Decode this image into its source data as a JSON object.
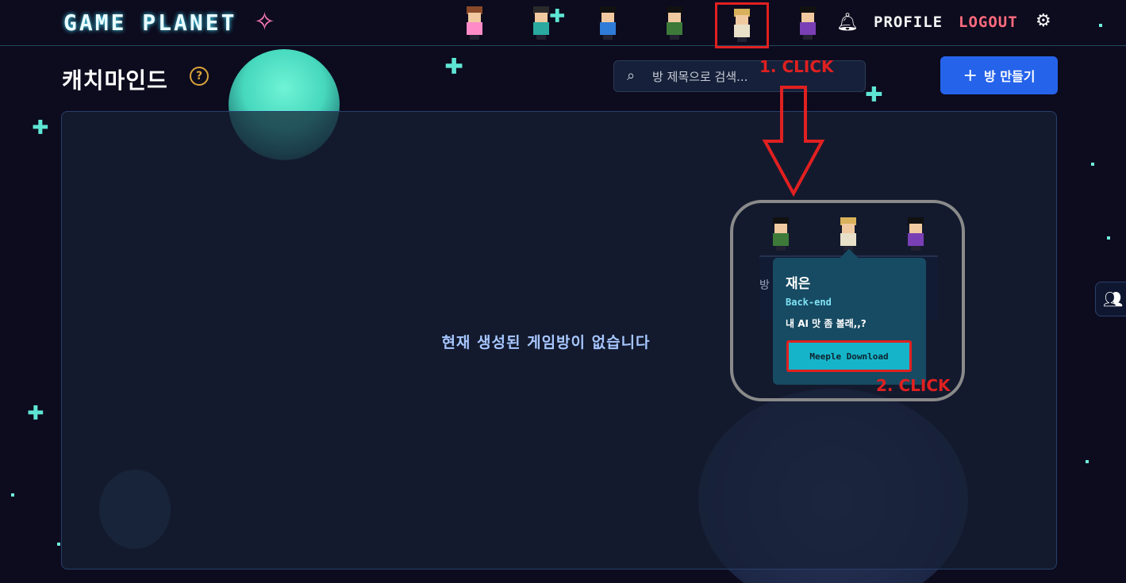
{
  "header": {
    "logo": "GAME PLANET",
    "nav_profile": "PROFILE",
    "nav_logout": "LOGOUT",
    "icons": {
      "logo": "sparkle-icon",
      "bell": "bell-icon",
      "settings": "gear-icon"
    },
    "avatars": [
      {
        "name": "avatar-1",
        "hair": "#8a4a2a",
        "shirt": "#ff8cc8"
      },
      {
        "name": "avatar-2",
        "hair": "#2a2a2a",
        "shirt": "#2aa9a0"
      },
      {
        "name": "avatar-3",
        "hair": "#111111",
        "shirt": "#2f7bd8"
      },
      {
        "name": "avatar-4",
        "hair": "#111111",
        "shirt": "#3d7a3a"
      },
      {
        "name": "avatar-5",
        "hair": "#d8b15a",
        "shirt": "#e8e0c8",
        "selected": true
      },
      {
        "name": "avatar-6",
        "hair": "#111111",
        "shirt": "#7a3fb5"
      }
    ]
  },
  "page": {
    "title": "캐치마인드",
    "help_icon": "help-icon"
  },
  "search": {
    "placeholder": "방 제목으로 검색..."
  },
  "actions": {
    "create_room": "방 만들기"
  },
  "main": {
    "empty_message": "현재 생성된 게임방이 없습니다"
  },
  "annotations": {
    "step1": "1. CLICK",
    "step2": "2. CLICK"
  },
  "zoom": {
    "strip_text": "방"
  },
  "popover": {
    "name": "재은",
    "role": "Back-end",
    "message": "내 AI 맛 좀 볼래,,?",
    "button": "Meeple Download"
  },
  "sidebar_toggle": "users-icon",
  "colors": {
    "accent": "#2563eb",
    "logout": "#ff6b7d",
    "highlight": "#e02020",
    "popover": "#164b63",
    "popover_button": "#16b4c9"
  }
}
